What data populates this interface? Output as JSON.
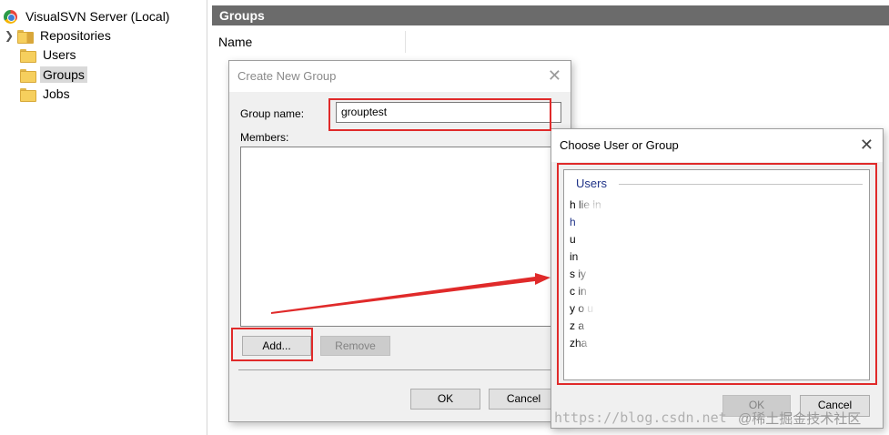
{
  "tree": {
    "root": "VisualSVN Server (Local)",
    "items": [
      {
        "label": "Repositories",
        "expandable": true
      },
      {
        "label": "Users"
      },
      {
        "label": "Groups",
        "selected": true
      },
      {
        "label": "Jobs"
      }
    ]
  },
  "panel": {
    "title": "Groups",
    "column_name": "Name"
  },
  "create_group": {
    "title": "Create New Group",
    "group_name_label": "Group name:",
    "group_name_value": "grouptest",
    "members_label": "Members:",
    "add_button": "Add...",
    "remove_button": "Remove",
    "ok_button": "OK",
    "cancel_button": "Cancel",
    "close_glyph": "✕"
  },
  "choose_dialog": {
    "title": "Choose User or Group",
    "group_header": "Users",
    "users": [
      "h      lie    in",
      "h",
      "         u",
      "           in",
      "s        iy",
      "c        in",
      "y          o     u",
      "z          a",
      "zha"
    ],
    "ok_button": "OK",
    "cancel_button": "Cancel",
    "close_glyph": "✕"
  },
  "watermark": {
    "url": "https://blog.csdn.net",
    "site": "@稀土掘金技术社区"
  },
  "colors": {
    "annotation_red": "#e02a2a",
    "header_gray": "#6b6b6b",
    "group_header_blue": "#1e3287"
  },
  "icons": {
    "root": "visualsvn-logo-icon",
    "expand": "chevron-right-icon",
    "folder": "folder-icon",
    "close": "close-icon"
  }
}
